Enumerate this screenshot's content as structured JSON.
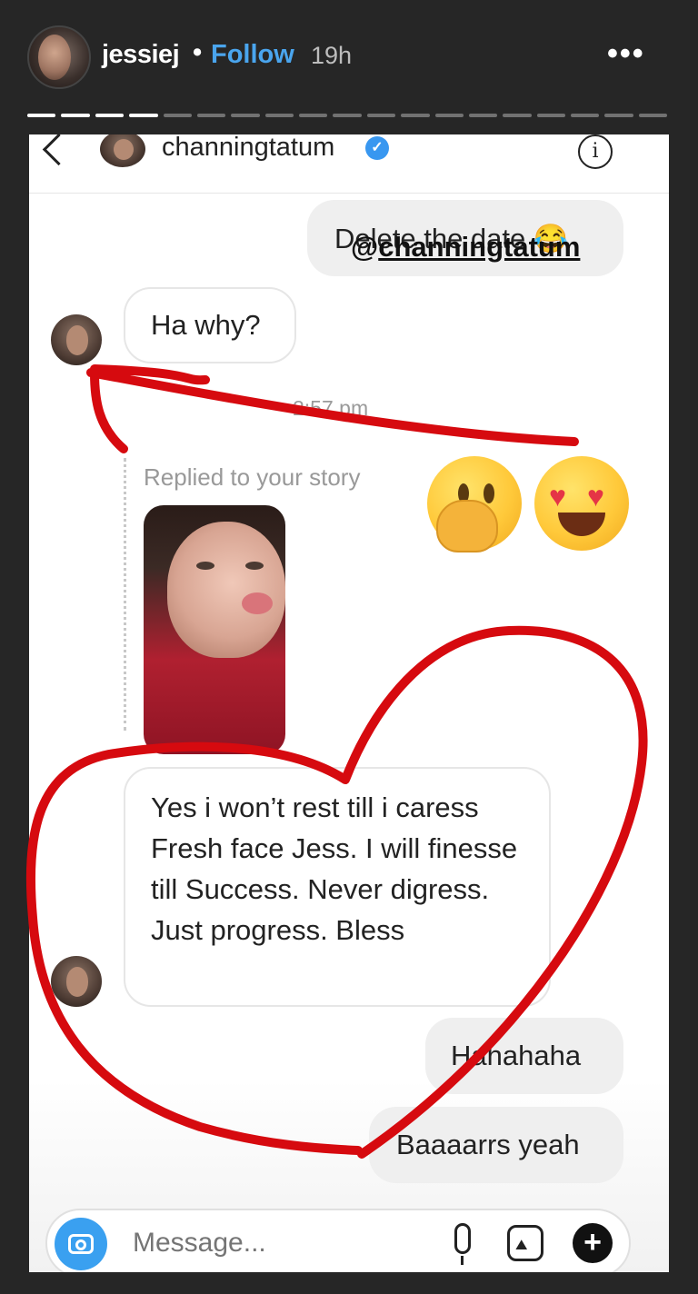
{
  "story": {
    "username": "jessiej",
    "separator": "•",
    "follow_label": "Follow",
    "time_ago": "19h",
    "more_icon": "more-horizontal-icon",
    "more_glyph": "•••",
    "progress_total": 19,
    "progress_done": 4
  },
  "dm": {
    "contact_name": "channingtatum",
    "verified_glyph": "✓",
    "info_glyph": "i"
  },
  "messages": {
    "m1": "Delete the date 😂",
    "m2": "Ha why?",
    "timestamp": "2:57 pm",
    "reply_label": "Replied to your story",
    "reply_emojis": [
      "hand-over-mouth-emoji",
      "heart-eyes-emoji"
    ],
    "m3": "Yes i won’t rest till i caress Fresh face Jess. I will finesse till Success. Never digress. Just progress. Bless",
    "m4": "Hahahaha",
    "m5": "Baaaarrs yeah"
  },
  "overlay": {
    "mention_at": "@",
    "mention_name": "channingtatum",
    "ink_color": "#d60a0f"
  },
  "composer": {
    "placeholder": "Message...",
    "plus_glyph": "+",
    "photo_glyph": "⛰"
  },
  "colors": {
    "story_bg": "#262626",
    "follow_blue": "#4aa5ee",
    "bubble_out": "#efefef",
    "camera_blue": "#3aa0f0"
  }
}
